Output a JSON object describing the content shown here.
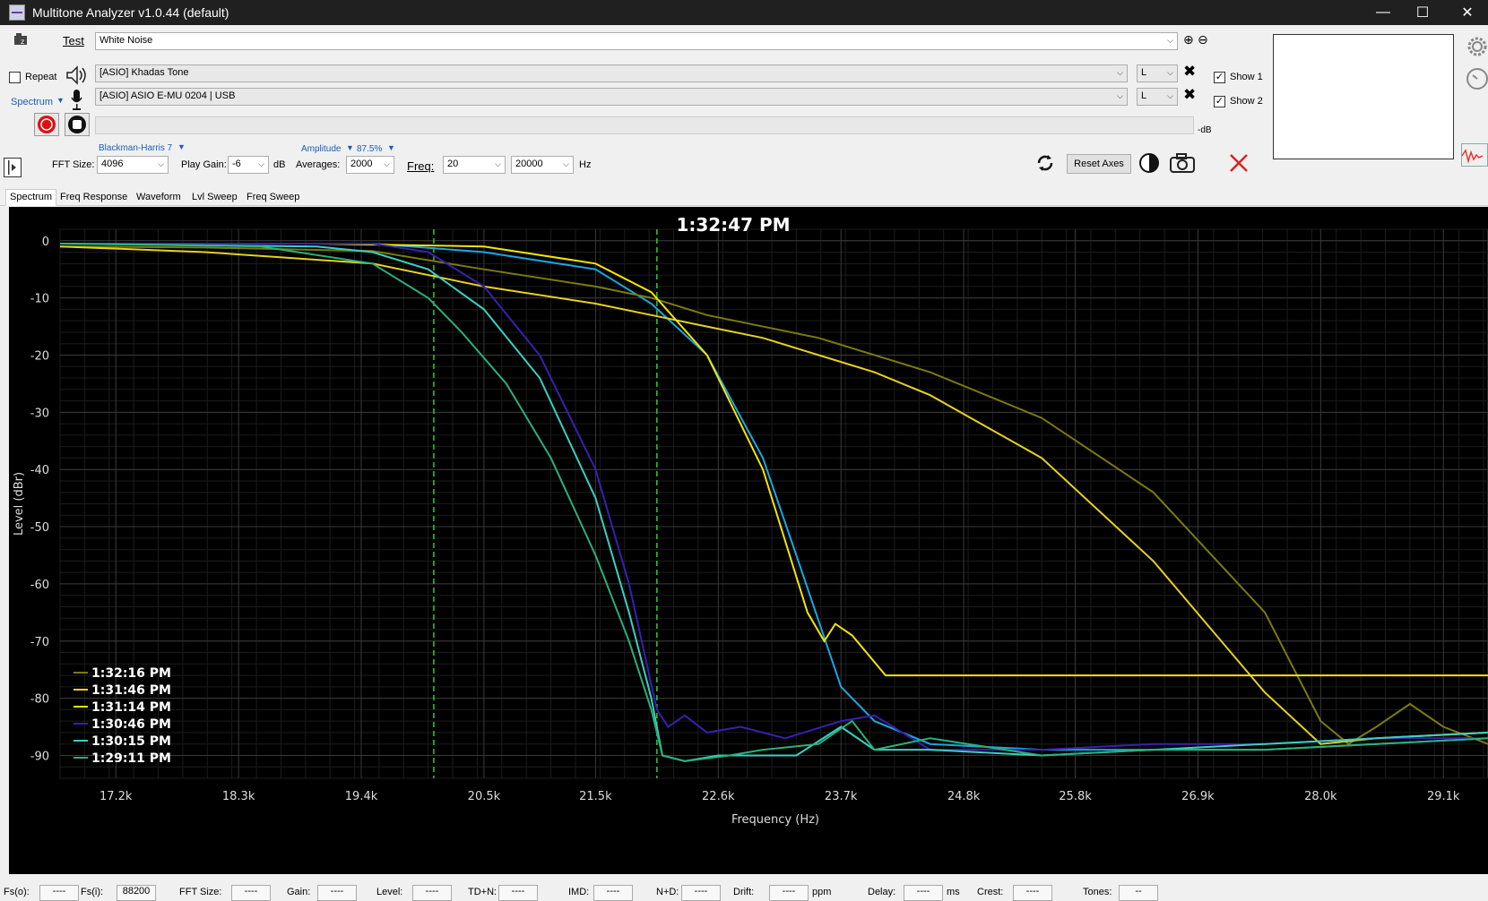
{
  "window": {
    "title": "Multitone Analyzer v1.0.44 (default)",
    "minimize": "—",
    "maximize": "☐",
    "close": "✕"
  },
  "row1": {
    "test_label": "Test",
    "test_value": "White Noise"
  },
  "row2": {
    "repeat_label": "Repeat",
    "output_device": "[ASIO] Khadas Tone",
    "output_channel": "L",
    "show1_label": "Show 1"
  },
  "row3": {
    "spectrum_label": "Spectrum",
    "input_device": "[ASIO] ASIO E-MU 0204 | USB",
    "input_channel": "L",
    "show2_label": "Show 2"
  },
  "row4": {
    "db_suffix": "-dB"
  },
  "settings": {
    "window_fn": "Blackman-Harris 7",
    "amplitude_label": "Amplitude",
    "amplitude_value": "87.5%",
    "fft_label": "FFT Size:",
    "fft_value": "4096",
    "play_gain_label": "Play Gain:",
    "play_gain_value": "-6",
    "play_gain_unit": "dB",
    "averages_label": "Averages:",
    "averages_value": "2000",
    "freq_label": "Freq:",
    "freq_min": "20",
    "freq_max": "20000",
    "freq_unit": "Hz",
    "reset_axes": "Reset Axes"
  },
  "tabs": [
    "Spectrum",
    "Freq Response",
    "Waveform",
    "Lvl Sweep",
    "Freq Sweep"
  ],
  "statusbar": [
    {
      "label": "Fs(o):",
      "value": "----"
    },
    {
      "label": "Fs(i):",
      "value": "88200"
    },
    {
      "label": "FFT Size:",
      "value": "----"
    },
    {
      "label": "Gain:",
      "value": "----"
    },
    {
      "label": "Level:",
      "value": "----"
    },
    {
      "label": "TD+N:",
      "value": "----"
    },
    {
      "label": "IMD:",
      "value": "----"
    },
    {
      "label": "N+D:",
      "value": "----"
    },
    {
      "label": "Drift:",
      "value": "----",
      "unit": "ppm"
    },
    {
      "label": "Delay:",
      "value": "----",
      "unit": "ms"
    },
    {
      "label": "Crest:",
      "value": "----"
    },
    {
      "label": "Tones:",
      "value": "--"
    }
  ],
  "chart_data": {
    "type": "line",
    "title": "1:32:47 PM",
    "xlabel": "Frequency (Hz)",
    "ylabel": "Level (dBr)",
    "xlim": [
      16700,
      29500
    ],
    "ylim": [
      -94,
      2
    ],
    "x_ticks": [
      17200,
      18300,
      19400,
      20500,
      21500,
      22600,
      23700,
      24800,
      25800,
      26900,
      28000,
      29100
    ],
    "x_tick_labels": [
      "17.2k",
      "18.3k",
      "19.4k",
      "20.5k",
      "21.5k",
      "22.6k",
      "23.7k",
      "24.8k",
      "25.8k",
      "26.9k",
      "28.0k",
      "29.1k"
    ],
    "y_ticks": [
      0,
      -10,
      -20,
      -30,
      -40,
      -50,
      -60,
      -70,
      -80,
      -90
    ],
    "grid": true,
    "cursors_x": [
      20050,
      22050
    ],
    "legend_position": "bottom-left",
    "series": [
      {
        "name": "1:32:16 PM",
        "color": "#7a7a10",
        "x": [
          16700,
          18000,
          19500,
          20500,
          21500,
          22000,
          22500,
          23500,
          24500,
          25500,
          26500,
          27500,
          28000,
          28250,
          28500,
          28800,
          29100,
          29500
        ],
        "y": [
          -1,
          -1.2,
          -1.8,
          -5,
          -8,
          -10,
          -13,
          -17,
          -23,
          -31,
          -44,
          -65,
          -84,
          -88,
          -85,
          -81,
          -85,
          -88
        ]
      },
      {
        "name": "1:31:46 PM",
        "color": "#e6d21e",
        "x": [
          16700,
          18000,
          19500,
          20500,
          21500,
          22000,
          22500,
          23000,
          23500,
          24000,
          24500,
          25500,
          26500,
          27500,
          28000,
          28500,
          29500
        ],
        "y": [
          -1,
          -2,
          -4,
          -8,
          -11,
          -13,
          -15,
          -17,
          -20,
          -23,
          -27,
          -38,
          -56,
          -79,
          -88,
          -87,
          -86
        ]
      },
      {
        "name": "1:31:14 PM",
        "color": "#f2e600",
        "x": [
          16700,
          19000,
          20500,
          21500,
          22000,
          22500,
          23000,
          23400,
          23550,
          23650,
          23800,
          24100,
          25000,
          26000,
          27000,
          28000,
          29500
        ],
        "y": [
          -0.5,
          -0.5,
          -1,
          -4,
          -9,
          -20,
          -40,
          -65,
          -70,
          -67,
          -69,
          -76,
          -76,
          -76,
          -76,
          -76,
          -76
        ]
      },
      {
        "name": "1:30:46 PM",
        "color": "#3a1fb0",
        "x": [
          16700,
          19500,
          20000,
          20500,
          21000,
          21500,
          21800,
          22050,
          22150,
          22300,
          22500,
          22800,
          23200,
          23700,
          24000,
          24500,
          25500,
          26500,
          27500,
          28500,
          29500
        ],
        "y": [
          -0.5,
          -0.5,
          -2,
          -8,
          -20,
          -40,
          -60,
          -82,
          -85,
          -83,
          -86,
          -85,
          -87,
          -84,
          -83,
          -89,
          -89,
          -88,
          -88,
          -87,
          -87
        ]
      },
      {
        "name": "1:30:15 PM",
        "color": "#3ad0c0",
        "x": [
          16700,
          19000,
          19500,
          20000,
          20500,
          21000,
          21500,
          21800,
          22000,
          22100,
          22300,
          22600,
          23000,
          23300,
          23700,
          24000,
          24500,
          25500,
          26500,
          27500,
          28500,
          29500
        ],
        "y": [
          -0.5,
          -1,
          -2,
          -5,
          -12,
          -24,
          -45,
          -65,
          -80,
          -90,
          -91,
          -90,
          -90,
          -90,
          -85,
          -89,
          -89,
          -90,
          -89,
          -88,
          -87,
          -86
        ]
      },
      {
        "name": "1:29:11 PM",
        "color": "#2ab07a",
        "x": [
          16700,
          18500,
          19500,
          20000,
          20300,
          20700,
          21100,
          21500,
          21800,
          22000,
          22100,
          22300,
          22700,
          23000,
          23500,
          23800,
          24000,
          24500,
          25500,
          26500,
          27500,
          28500,
          29500
        ],
        "y": [
          -0.5,
          -1,
          -4,
          -10,
          -16,
          -25,
          -38,
          -55,
          -70,
          -82,
          -90,
          -91,
          -90,
          -89,
          -88,
          -84,
          -89,
          -87,
          -90,
          -89,
          -89,
          -88,
          -87
        ]
      }
    ],
    "extra_series_cyan": {
      "color": "#1aa6e0",
      "x": [
        16700,
        19500,
        20500,
        21500,
        22000,
        22500,
        23000,
        23300,
        23700,
        24000,
        24500,
        25500,
        26500,
        27500,
        28500,
        29500
      ],
      "y": [
        -0.5,
        -0.5,
        -2,
        -5,
        -11,
        -20,
        -38,
        -55,
        -78,
        -84,
        -88,
        -89,
        -89,
        -89,
        -88,
        -87
      ]
    }
  }
}
